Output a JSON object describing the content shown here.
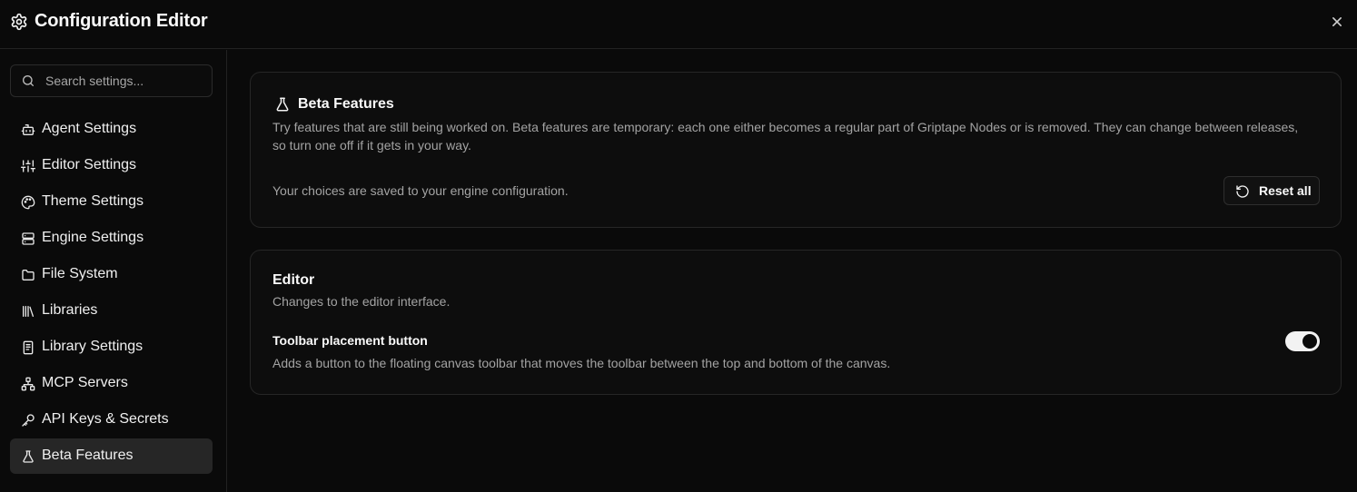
{
  "header": {
    "title": "Configuration Editor"
  },
  "search": {
    "placeholder": "Search settings..."
  },
  "sidebar": {
    "items": [
      {
        "label": "Agent Settings",
        "icon": "bot-icon",
        "active": false
      },
      {
        "label": "Editor Settings",
        "icon": "sliders-icon",
        "active": false
      },
      {
        "label": "Theme Settings",
        "icon": "palette-icon",
        "active": false
      },
      {
        "label": "Engine Settings",
        "icon": "server-icon",
        "active": false
      },
      {
        "label": "File System",
        "icon": "folder-icon",
        "active": false
      },
      {
        "label": "Libraries",
        "icon": "library-icon",
        "active": false
      },
      {
        "label": "Library Settings",
        "icon": "book-icon",
        "active": false
      },
      {
        "label": "MCP Servers",
        "icon": "network-icon",
        "active": false
      },
      {
        "label": "API Keys & Secrets",
        "icon": "key-icon",
        "active": false
      },
      {
        "label": "Beta Features",
        "icon": "flask-icon",
        "active": true
      }
    ]
  },
  "beta": {
    "title": "Beta Features",
    "description": "Try features that are still being worked on. Beta features are temporary: each one either becomes a regular part of Griptape Nodes or is removed. They can change between releases, so turn one off if it gets in your way.",
    "saved_note": "Your choices are saved to your engine configuration.",
    "reset_label": "Reset all"
  },
  "editor": {
    "title": "Editor",
    "description": "Changes to the editor interface.",
    "setting_title": "Toolbar placement button",
    "setting_description": "Adds a button to the floating canvas toolbar that moves the toolbar between the top and bottom of the canvas.",
    "enabled": true
  }
}
